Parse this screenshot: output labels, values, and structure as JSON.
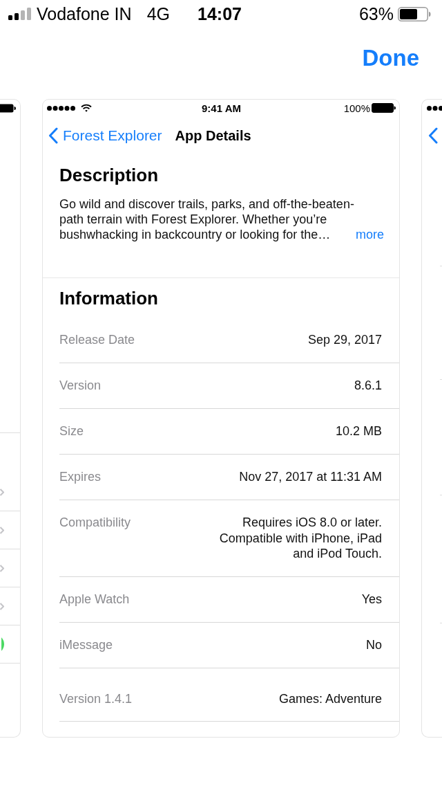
{
  "status_bar": {
    "carrier": "Vodafone IN",
    "network": "4G",
    "time": "14:07",
    "battery": "63%"
  },
  "header": {
    "done": "Done"
  },
  "left_preview": {
    "rows": [
      {
        "kind": "chevron"
      },
      {
        "kind": "chevron"
      },
      {
        "kind": "chevron"
      },
      {
        "kind": "chevron"
      },
      {
        "kind": "toggle",
        "on": true
      }
    ]
  },
  "card": {
    "status_bar": {
      "time": "9:41 AM",
      "battery": "100%"
    },
    "nav": {
      "back": "Forest Explorer",
      "title": "App Details"
    },
    "description": {
      "heading": "Description",
      "text": "Go wild and discover trails, parks, and off-the-beaten-path terrain with Forest Explorer. Whether you’re bushwhacking in backcountry or looking for the…",
      "more": "more"
    },
    "information": {
      "heading": "Information",
      "rows": [
        {
          "label": "Release Date",
          "value": "Sep 29, 2017"
        },
        {
          "label": "Version",
          "value": "8.6.1"
        },
        {
          "label": "Size",
          "value": "10.2 MB"
        },
        {
          "label": "Expires",
          "value": "Nov 27, 2017 at 11:31 AM"
        },
        {
          "label": "Compatibility",
          "value": "Requires iOS 8.0 or later.\nCompatible with iPhone, iPad\nand iPod Touch."
        },
        {
          "label": "Apple Watch",
          "value": "Yes"
        },
        {
          "label": "iMessage",
          "value": "No"
        }
      ]
    },
    "footer": {
      "version": "Version 1.4.1",
      "category": "Games: Adventure"
    }
  }
}
